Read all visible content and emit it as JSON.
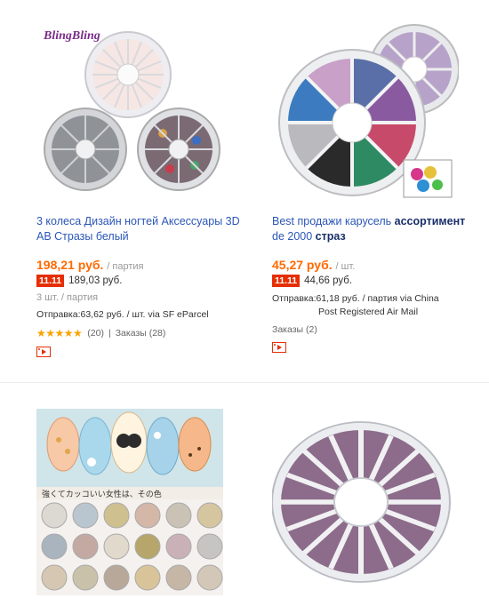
{
  "products": [
    {
      "brand_logo": "BlingBling",
      "title": "3 колеса Дизайн ногтей Аксессуары 3D AB Стразы белый",
      "price": "198,21 руб.",
      "unit": "/ партия",
      "promo_badge": "11.11",
      "promo_price": "189,03 руб.",
      "lot_info": "3 шт. / партия",
      "shipping_line1": "Отправка:63,62 руб. / шт. via SF eParcel",
      "rating_stars": "★★★★★",
      "reviews": "(20)",
      "separator": "|",
      "orders": "Заказы (28)",
      "icon": "video-icon"
    },
    {
      "title_part1": "Best продажи карусель ",
      "title_bold1": "ассортимент",
      "title_part2": " de 2000 ",
      "title_bold2": "страз",
      "price": "45,27 руб.",
      "unit": "/ шт.",
      "promo_badge": "11.11",
      "promo_price": "44,66 руб.",
      "shipping_line1": "Отправка:61,18 руб. / партия via China",
      "shipping_line2": "Post Registered Air Mail",
      "orders": "Заказы (2)",
      "icon": "video-icon"
    }
  ],
  "colors": {
    "price": "#ff6a00",
    "badge": "#e62e04",
    "link": "#2b56b8",
    "star": "#f7a300"
  }
}
